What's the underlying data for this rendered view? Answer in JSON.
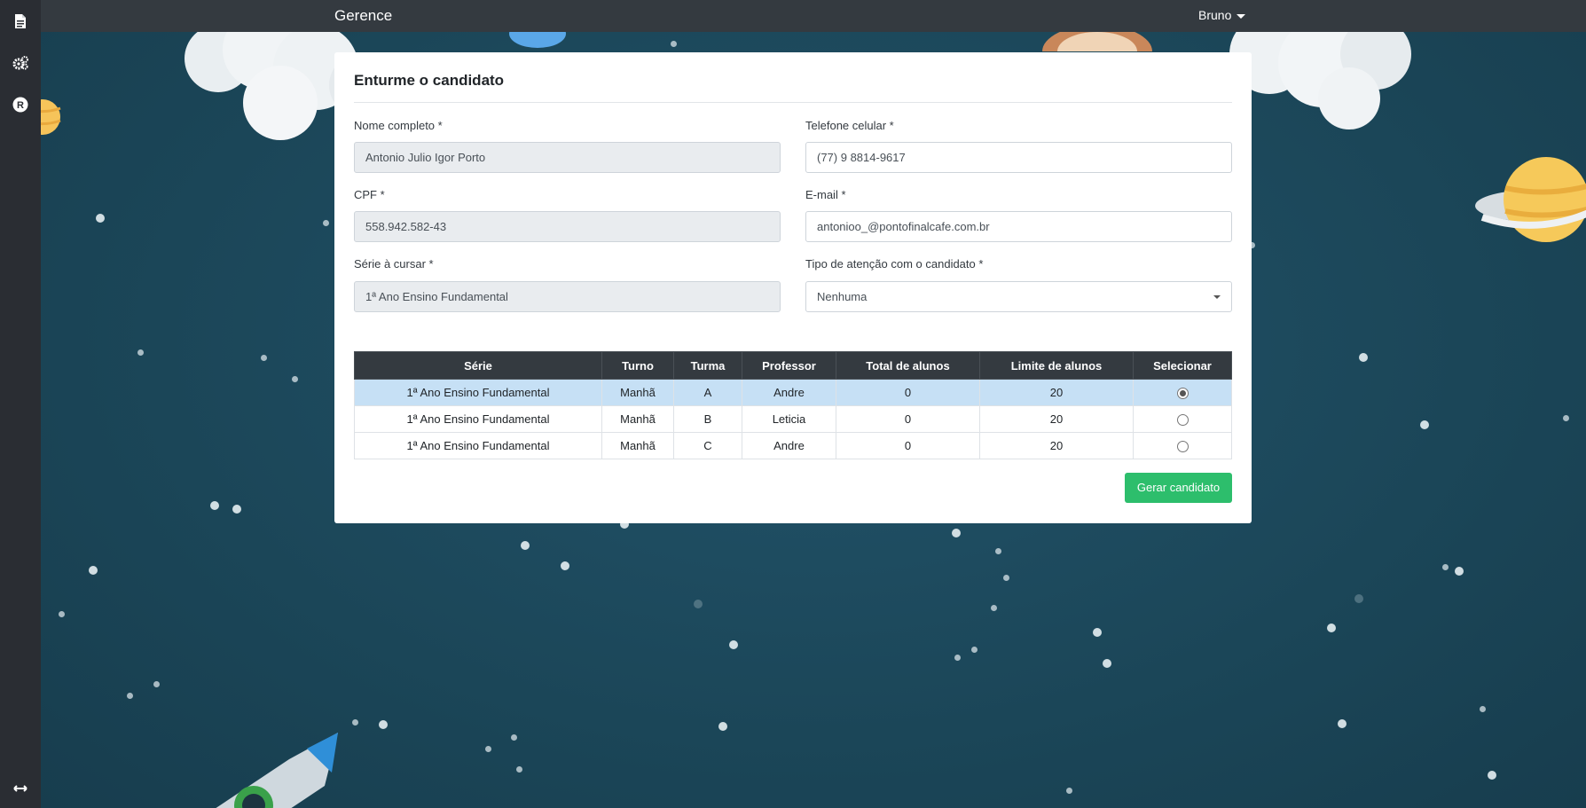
{
  "app": {
    "brand": "Gerence",
    "user": "Bruno"
  },
  "sidebar": {
    "icons": [
      "document-icon",
      "gears-icon",
      "registered-icon",
      "expand-arrows-icon"
    ]
  },
  "form": {
    "title": "Enturme o candidato",
    "nome_label": "Nome completo *",
    "nome_value": "Antonio Julio Igor Porto",
    "telefone_label": "Telefone celular *",
    "telefone_value": "(77) 9 8814-9617",
    "cpf_label": "CPF *",
    "cpf_value": "558.942.582-43",
    "email_label": "E-mail *",
    "email_value": "antonioo_@pontofinalcafe.com.br",
    "serie_label": "Série à cursar *",
    "serie_value": "1ª Ano Ensino Fundamental",
    "atencao_label": "Tipo de atenção com o candidato *",
    "atencao_value": "Nenhuma"
  },
  "table": {
    "headers": [
      "Série",
      "Turno",
      "Turma",
      "Professor",
      "Total de alunos",
      "Limite de alunos",
      "Selecionar"
    ],
    "rows": [
      {
        "serie": "1ª Ano Ensino Fundamental",
        "turno": "Manhã",
        "turma": "A",
        "professor": "Andre",
        "total": "0",
        "limite": "20",
        "selected": true
      },
      {
        "serie": "1ª Ano Ensino Fundamental",
        "turno": "Manhã",
        "turma": "B",
        "professor": "Leticia",
        "total": "0",
        "limite": "20",
        "selected": false
      },
      {
        "serie": "1ª Ano Ensino Fundamental",
        "turno": "Manhã",
        "turma": "C",
        "professor": "Andre",
        "total": "0",
        "limite": "20",
        "selected": false
      }
    ]
  },
  "actions": {
    "gerar_label": "Gerar candidato"
  },
  "colors": {
    "sidebar": "#2a2d33",
    "navbar": "#343a40",
    "accent_green": "#2dbe6c",
    "selected_row": "#c6e0f5",
    "background": "#1d4a5c"
  }
}
